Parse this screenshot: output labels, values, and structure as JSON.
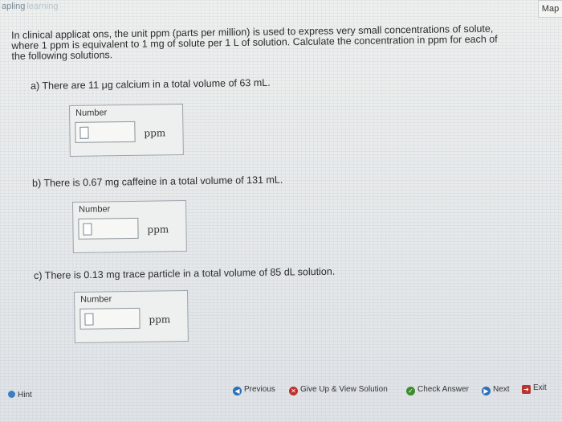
{
  "header": {
    "logo_main": "apling",
    "logo_sub": "learning",
    "map_label": "Map"
  },
  "question": {
    "line1": "In clinical applicat ons, the unit ppm (parts per million) is used to express very small concentrations of solute,",
    "line2": "where 1 ppm is equivalent to 1 mg of solute per 1 L of solution. Calculate the concentration in ppm for each of",
    "line3": "the following solutions."
  },
  "parts": [
    {
      "prompt": "a) There are 11 μg calcium in a total volume of 63 mL.",
      "label": "Number",
      "unit": "ppm",
      "value": ""
    },
    {
      "prompt": "b) There is 0.67 mg caffeine in a total volume of 131 mL.",
      "label": "Number",
      "unit": "ppm",
      "value": ""
    },
    {
      "prompt": "c) There is 0.13 mg trace particle in a total volume of 85 dL solution.",
      "label": "Number",
      "unit": "ppm",
      "value": ""
    }
  ],
  "footer": {
    "hint": "Hint",
    "previous": "Previous",
    "give_up": "Give Up & View Solution",
    "check": "Check Answer",
    "next": "Next",
    "exit": "Exit"
  }
}
